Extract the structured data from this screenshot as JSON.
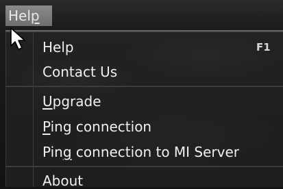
{
  "menubar": {
    "help_label_before": "Hel",
    "help_label_mnemonic": "p"
  },
  "menu": {
    "help": {
      "label": "Help",
      "shortcut": "F1"
    },
    "contact": {
      "label": "Contact Us"
    },
    "upgrade": {
      "mnemonic": "U",
      "rest": "pgrade"
    },
    "ping": {
      "mnemonic": "P",
      "rest": "ing connection"
    },
    "ping_mi": {
      "before": "Pin",
      "mnemonic": "g",
      "after": " connection to MI Server"
    },
    "about": {
      "label": "About"
    }
  },
  "cursor_icon": "arrow-pointer-icon"
}
